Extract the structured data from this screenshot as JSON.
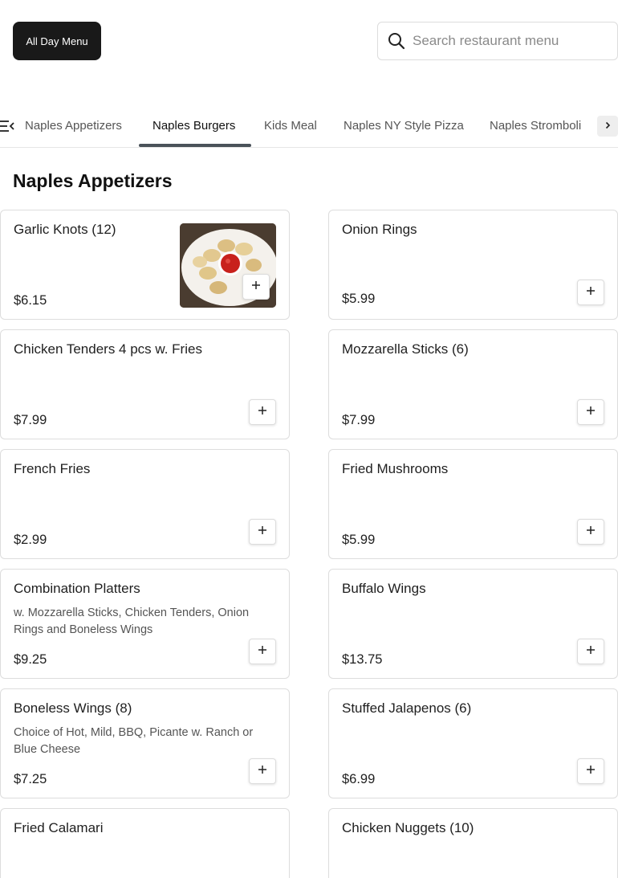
{
  "header": {
    "menu_button_label": "All Day Menu",
    "search_placeholder": "Search restaurant menu"
  },
  "tabs": [
    {
      "label": "Naples Appetizers"
    },
    {
      "label": "Naples Burgers"
    },
    {
      "label": "Kids Meal"
    },
    {
      "label": "Naples NY Style Pizza"
    },
    {
      "label": "Naples Stromboli"
    }
  ],
  "active_tab": "Naples Burgers",
  "section": {
    "title": "Naples Appetizers",
    "items": [
      {
        "name": "Garlic Knots (12)",
        "desc": "",
        "price": "$6.15",
        "has_image": true
      },
      {
        "name": "Onion Rings",
        "desc": "",
        "price": "$5.99"
      },
      {
        "name": "Chicken Tenders 4 pcs w. Fries",
        "desc": "",
        "price": "$7.99"
      },
      {
        "name": "Mozzarella Sticks (6)",
        "desc": "",
        "price": "$7.99"
      },
      {
        "name": "French Fries",
        "desc": "",
        "price": "$2.99"
      },
      {
        "name": "Fried Mushrooms",
        "desc": "",
        "price": "$5.99"
      },
      {
        "name": "Combination Platters",
        "desc": "w. Mozzarella Sticks, Chicken Tenders, Onion Rings and Boneless Wings",
        "price": "$9.25"
      },
      {
        "name": "Buffalo Wings",
        "desc": "",
        "price": "$13.75"
      },
      {
        "name": "Boneless Wings (8)",
        "desc": "Choice of Hot, Mild, BBQ, Picante w. Ranch or Blue Cheese",
        "price": "$7.25"
      },
      {
        "name": "Stuffed Jalapenos (6)",
        "desc": "",
        "price": "$6.99"
      },
      {
        "name": "Fried Calamari",
        "desc": "",
        "price": ""
      },
      {
        "name": "Chicken Nuggets (10)",
        "desc": "",
        "price": ""
      }
    ]
  },
  "colors": {
    "menu_button_bg": "#191919",
    "active_tab_indicator": "#4a5259"
  },
  "icons": {
    "search": "search-icon",
    "tabs_menu": "menu-list-icon",
    "scroll_right": "chevron-right-icon",
    "add": "plus-icon"
  }
}
